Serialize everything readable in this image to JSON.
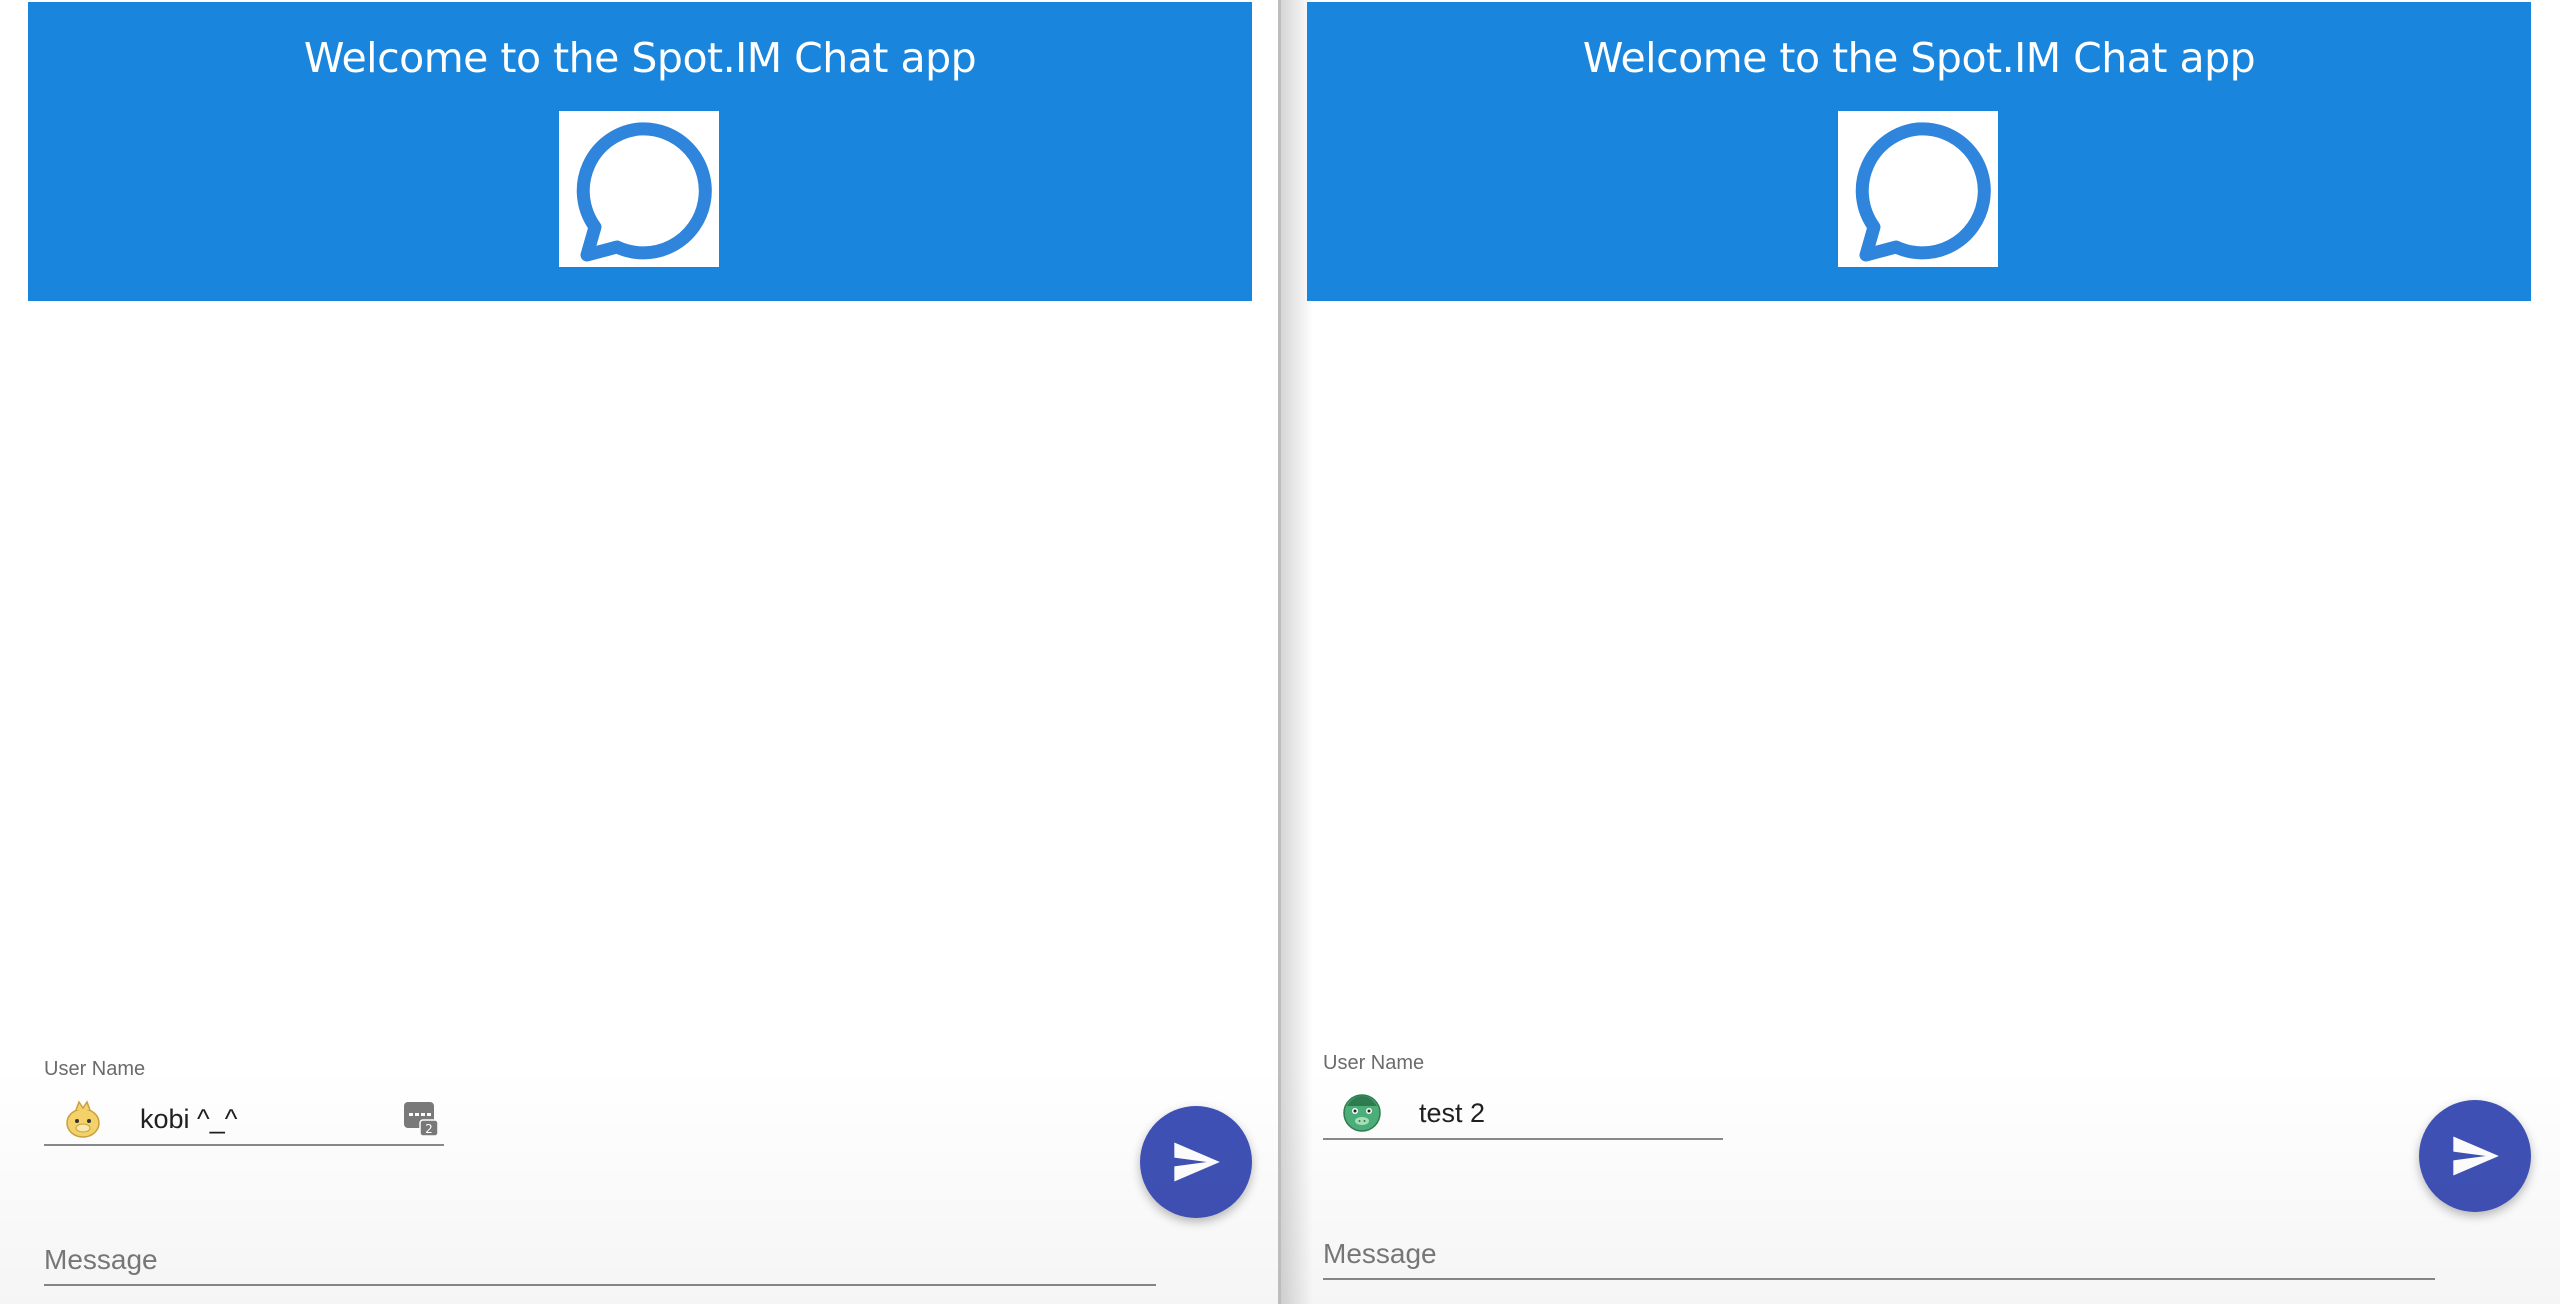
{
  "colors": {
    "header_bg": "#1a85dc",
    "send_button_bg": "#3f51b5",
    "logo_stroke": "#2f84db"
  },
  "panes": [
    {
      "header": {
        "title": "Welcome to the Spot.IM Chat app"
      },
      "user": {
        "label": "User Name",
        "value": "kobi ^_^",
        "avatar_icon": "yellow-creature-avatar",
        "has_keyboard_badge_icon": true
      },
      "message": {
        "placeholder": "Message"
      },
      "send": {
        "icon": "send-icon"
      }
    },
    {
      "header": {
        "title": "Welcome to the Spot.IM Chat app"
      },
      "user": {
        "label": "User Name",
        "value": "test 2",
        "avatar_icon": "green-creature-avatar",
        "has_keyboard_badge_icon": false
      },
      "message": {
        "placeholder": "Message"
      },
      "send": {
        "icon": "send-icon"
      }
    }
  ]
}
